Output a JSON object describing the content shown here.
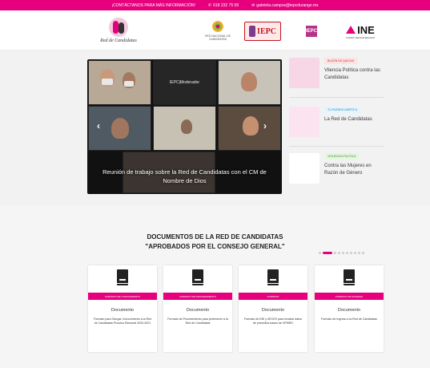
{
  "topbar": {
    "contact_label": "¡CONTÁCTANOS PARA MÁS INFORMACIÓN!",
    "phone": "618 232 75 09",
    "email": "gabriela.campos@iepcdurango.mx"
  },
  "logos": {
    "red": "Red de Candidatas",
    "rnc": "RED NACIONAL DE CANDIDATAS",
    "iepc": "IEPC",
    "iepc2_abbr": "IEPC",
    "ine": "INE",
    "ine_sub": "Instituto Nacional Electoral"
  },
  "carousel": {
    "moderator_label": "IEPC|Moderador",
    "caption": "Reunión de trabajo sobre la Red de Candidatas con el CM de Nombre de Dios",
    "prev_icon": "chevron-left-icon",
    "next_icon": "chevron-right-icon"
  },
  "news": [
    {
      "tag": "BUZÓN DE QUEJAS",
      "title": "Vilencia Política contra las Candidatas"
    },
    {
      "tag": "TU PUEDES UNIRTE A",
      "title": "La Red de Candidatas"
    },
    {
      "tag": "VIOLENCIA POLÍTICA",
      "title": "Contra las Mujeres en Razón de Género"
    }
  ],
  "section": {
    "title_line1": "DOCUMENTOS DE LA RED DE CANDIDATAS",
    "title_line2": "\"APROBADOS POR EL CONSEJO GENERAL\""
  },
  "pager": {
    "count": 10,
    "active": 1
  },
  "cards": [
    {
      "band": "FORMATO DE CONOCIMIENTO",
      "type": "Documento",
      "desc": "Formato para Otorgar Conocimiento a la Red de Candidatas Proceso Electoral 2020-2021"
    },
    {
      "band": "FORMATO DE PROCEDIMIENTO",
      "type": "Documento",
      "desc": "Formato de Procedimiento para pertenecer a la Red de Candidatas"
    },
    {
      "band": "FORMATO",
      "type": "Documento",
      "desc": "Formato de INE y IIECES para recabar datos de preselitos bases de VPMRG"
    },
    {
      "band": "FORMATO DE INGRESO",
      "type": "Documento",
      "desc": "Formato de Ingreso a la Red de Candidatas"
    }
  ],
  "colors": {
    "brand": "#e6007e",
    "background": "#f2f2f2"
  }
}
